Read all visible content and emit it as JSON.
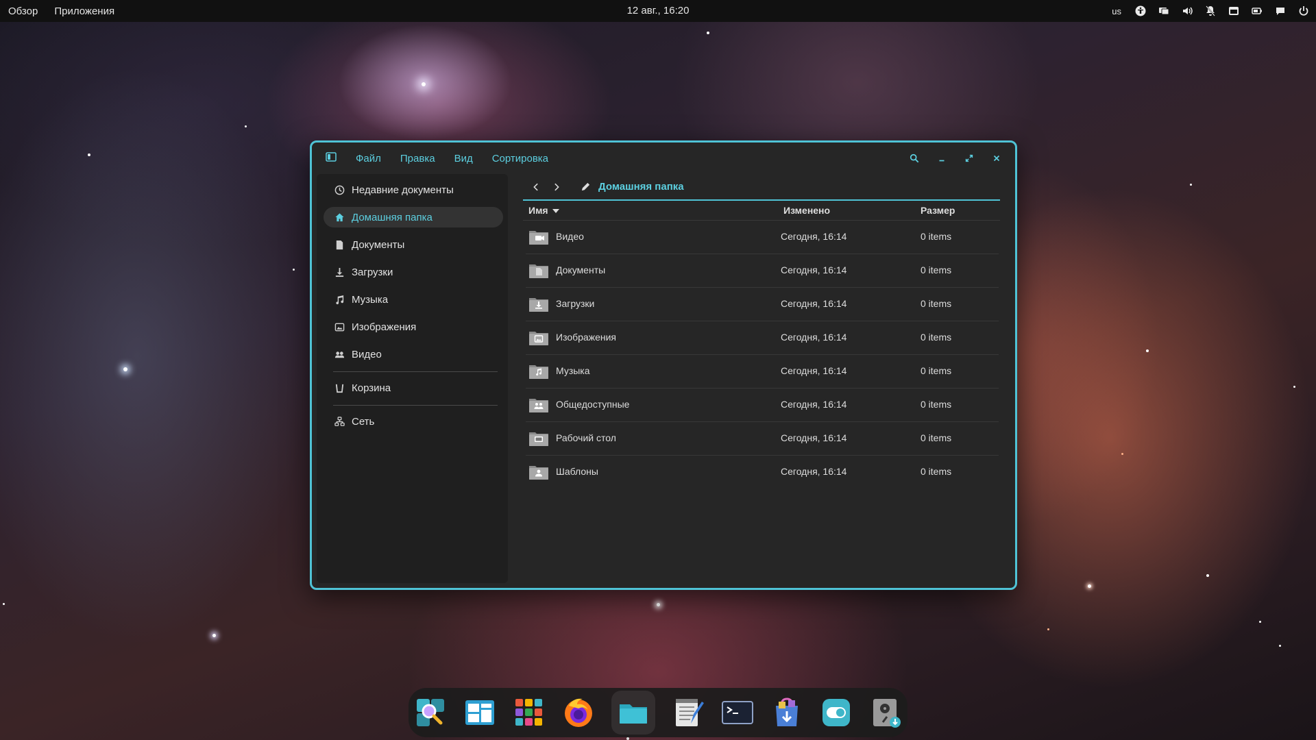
{
  "topbar": {
    "overview": "Обзор",
    "apps": "Приложения",
    "clock": "12 авг., 16:20",
    "keyboard_layout": "us",
    "tray_icons": [
      "accessibility-icon",
      "display-icon",
      "volume-icon",
      "notifications-off-icon",
      "calendar-icon",
      "battery-icon",
      "chat-icon",
      "power-icon"
    ]
  },
  "window": {
    "menu": [
      "Файл",
      "Правка",
      "Вид",
      "Сортировка"
    ],
    "path_title": "Домашняя папка",
    "accent_color": "#4fc3d6",
    "sidebar": [
      {
        "label": "Недавние документы",
        "icon": "clock-icon"
      },
      {
        "label": "Домашняя папка",
        "icon": "home-icon",
        "active": true
      },
      {
        "label": "Документы",
        "icon": "document-icon"
      },
      {
        "label": "Загрузки",
        "icon": "download-icon"
      },
      {
        "label": "Музыка",
        "icon": "music-icon"
      },
      {
        "label": "Изображения",
        "icon": "image-icon"
      },
      {
        "label": "Видео",
        "icon": "video-icon"
      },
      {
        "label": "Корзина",
        "icon": "trash-icon"
      },
      {
        "label": "Сеть",
        "icon": "network-icon"
      }
    ],
    "columns": {
      "name": "Имя",
      "modified": "Изменено",
      "size": "Размер"
    },
    "files": [
      {
        "name": "Видео",
        "modified": "Сегодня, 16:14",
        "size": "0 items",
        "icon": "video-folder-icon"
      },
      {
        "name": "Документы",
        "modified": "Сегодня, 16:14",
        "size": "0 items",
        "icon": "documents-folder-icon"
      },
      {
        "name": "Загрузки",
        "modified": "Сегодня, 16:14",
        "size": "0 items",
        "icon": "downloads-folder-icon"
      },
      {
        "name": "Изображения",
        "modified": "Сегодня, 16:14",
        "size": "0 items",
        "icon": "pictures-folder-icon"
      },
      {
        "name": "Музыка",
        "modified": "Сегодня, 16:14",
        "size": "0 items",
        "icon": "music-folder-icon"
      },
      {
        "name": "Общедоступные",
        "modified": "Сегодня, 16:14",
        "size": "0 items",
        "icon": "public-folder-icon"
      },
      {
        "name": "Рабочий стол",
        "modified": "Сегодня, 16:14",
        "size": "0 items",
        "icon": "desktop-folder-icon"
      },
      {
        "name": "Шаблоны",
        "modified": "Сегодня, 16:14",
        "size": "0 items",
        "icon": "templates-folder-icon"
      }
    ]
  },
  "dock": [
    "search-app-icon",
    "layout-app-icon",
    "app-grid-icon",
    "firefox-icon",
    "files-icon",
    "text-editor-icon",
    "terminal-icon",
    "software-installer-icon",
    "settings-toggle-icon",
    "disk-utility-icon"
  ]
}
